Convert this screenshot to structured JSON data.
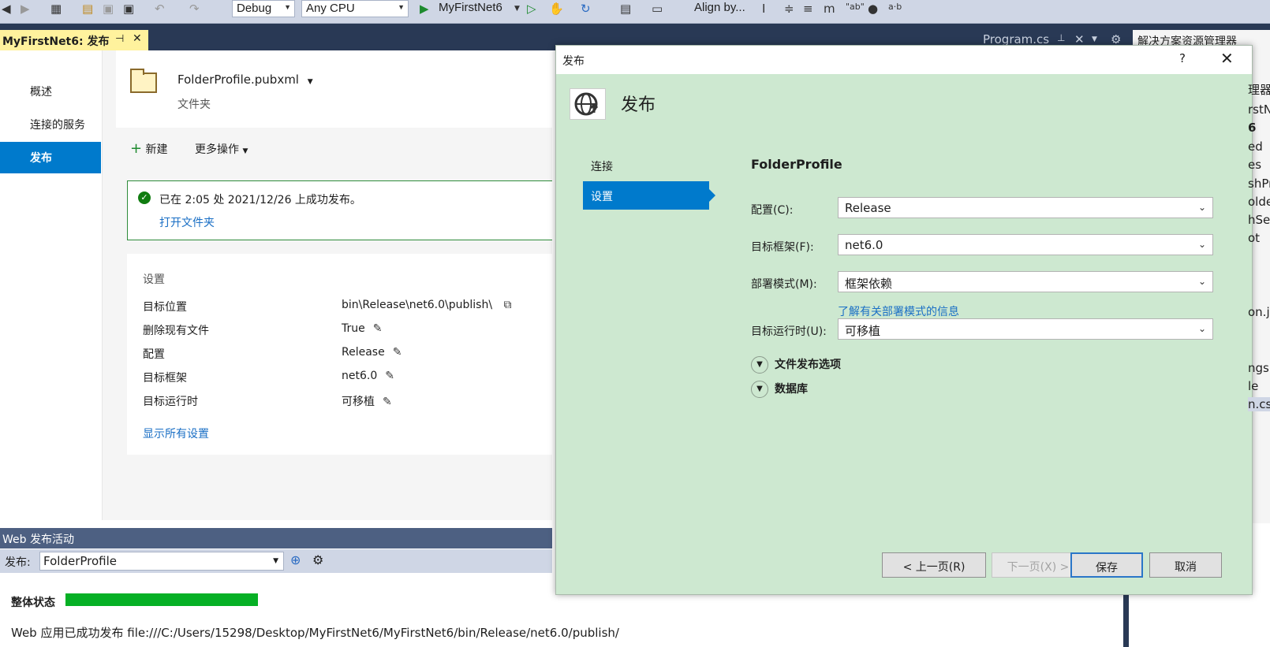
{
  "toolbar": {
    "config": "Debug",
    "platform": "Any CPU",
    "run_target": "MyFirstNet6",
    "align_label": "Align by..."
  },
  "tabs": {
    "active_doc": "MyFirstNet6: 发布",
    "program_tab": "Program.cs",
    "solution_explorer": "解决方案资源管理器"
  },
  "nav": {
    "items": [
      "概述",
      "连接的服务",
      "发布"
    ],
    "active": "发布"
  },
  "profile": {
    "name": "FolderProfile.pubxml",
    "type": "文件夹"
  },
  "actions": {
    "new": "新建",
    "more": "更多操作"
  },
  "success": {
    "message": "已在 2:05 处 2021/12/26 上成功发布。",
    "open_folder": "打开文件夹"
  },
  "settings": {
    "header": "设置",
    "rows": [
      {
        "key": "目标位置",
        "value": "bin\\Release\\net6.0\\publish\\"
      },
      {
        "key": "删除现有文件",
        "value": "True"
      },
      {
        "key": "配置",
        "value": "Release"
      },
      {
        "key": "目标框架",
        "value": "net6.0"
      },
      {
        "key": "目标运行时",
        "value": "可移植"
      }
    ],
    "show_all": "显示所有设置"
  },
  "activity": {
    "title": "Web 发布活动",
    "publish_label": "发布:",
    "profile": "FolderProfile",
    "status_label": "整体状态",
    "progress": 1.0,
    "result": "Web 应用已成功发布 file:///C:/Users/15298/Desktop/MyFirstNet6/MyFirstNet6/bin/Release/net6.0/publish/"
  },
  "right_sliver": [
    "理器(",
    "rstN",
    "6",
    "ed",
    "es",
    "shPr",
    "olde",
    "hSe",
    "ot",
    "on.j",
    "ngs",
    "le",
    "n.cs"
  ],
  "dialog": {
    "title": "发布",
    "help": "?",
    "heading": "发布",
    "steps": [
      "连接",
      "设置"
    ],
    "profile_name": "FolderProfile",
    "fields": [
      {
        "label": "配置(C):",
        "value": "Release"
      },
      {
        "label": "目标框架(F):",
        "value": "net6.0"
      },
      {
        "label": "部署模式(M):",
        "value": "框架依赖"
      },
      {
        "label": "目标运行时(U):",
        "value": "可移植"
      }
    ],
    "deploy_link": "了解有关部署模式的信息",
    "expanders": [
      "文件发布选项",
      "数据库"
    ],
    "buttons": {
      "prev": "< 上一页(R)",
      "next": "下一页(X) >",
      "save": "保存",
      "cancel": "取消"
    }
  }
}
